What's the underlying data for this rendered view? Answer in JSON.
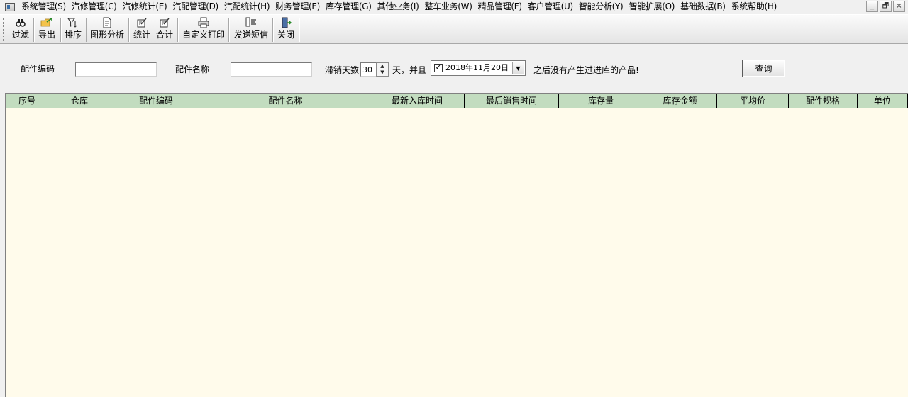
{
  "menu": {
    "items": [
      "系统管理(S)",
      "汽修管理(C)",
      "汽修统计(E)",
      "汽配管理(D)",
      "汽配统计(H)",
      "财务管理(E)",
      "库存管理(G)",
      "其他业务(I)",
      "整车业务(W)",
      "精品管理(F)",
      "客户管理(U)",
      "智能分析(Y)",
      "智能扩展(O)",
      "基础数据(B)",
      "系统帮助(H)"
    ],
    "window_controls": [
      "_",
      "🗗",
      "×"
    ]
  },
  "toolbar": {
    "filter": "过滤",
    "export": "导出",
    "sort": "排序",
    "chart_analysis": "图形分析",
    "statistics": "统计",
    "total": "合计",
    "custom_print": "自定义打印",
    "send_sms": "发送短信",
    "close": "关闭"
  },
  "filter": {
    "part_code_label": "配件编码",
    "part_code_value": "",
    "part_name_label": "配件名称",
    "part_name_value": "",
    "slow_days_label": "滞销天数",
    "slow_days_value": "30",
    "days_and_label": "天，并且",
    "date_checked": "✓",
    "date_value": "2018年11月20日",
    "after_label": "之后没有产生过进库的产品!",
    "query_button": "查询"
  },
  "grid": {
    "columns": [
      "序号",
      "仓库",
      "配件编码",
      "配件名称",
      "最新入库时间",
      "最后销售时间",
      "库存量",
      "库存金额",
      "平均价",
      "配件规格",
      "单位"
    ],
    "rows": []
  },
  "colors": {
    "header_bg": "#c2dcbf",
    "grid_bg": "#fffbeb"
  }
}
